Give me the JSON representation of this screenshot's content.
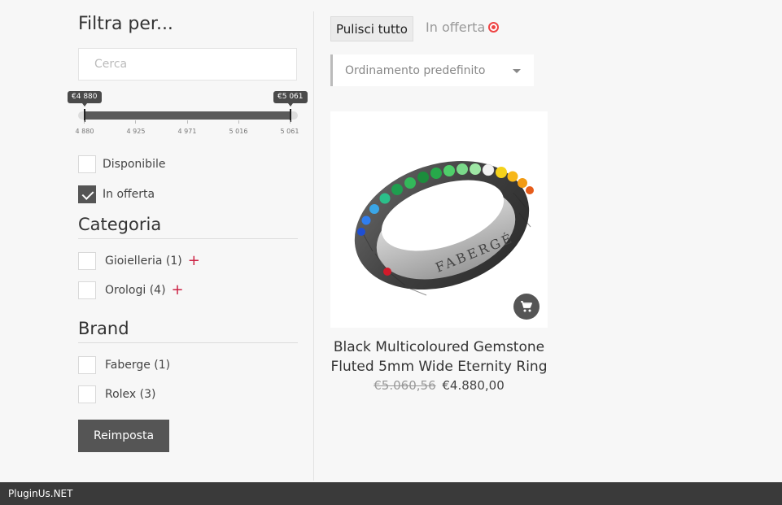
{
  "sidebar": {
    "title": "Filtra per...",
    "search_placeholder": "Cerca",
    "price_slider": {
      "min_label": "€4 880",
      "max_label": "€5 061",
      "ticks": [
        "4 880",
        "4 925",
        "4 971",
        "5 016",
        "5 061"
      ]
    },
    "availability": {
      "label": "Disponibile",
      "checked": false
    },
    "on_sale": {
      "label": "In offerta",
      "checked": true
    },
    "category": {
      "title": "Categoria",
      "items": [
        {
          "label": "Gioielleria (1)"
        },
        {
          "label": "Orologi (4)"
        }
      ]
    },
    "brand": {
      "title": "Brand",
      "items": [
        {
          "label": "Faberge (1)"
        },
        {
          "label": "Rolex (3)"
        }
      ]
    },
    "reset_label": "Reimposta"
  },
  "toolbar": {
    "clear_all_label": "Pulisci tutto",
    "active_filter_label": "In offerta",
    "sort_label": "Ordinamento predefinito"
  },
  "product": {
    "title": "Black Multicoloured Gemstone Fluted 5mm Wide Eternity Ring",
    "old_price": "€5.060,56",
    "new_price": "€4.880,00",
    "engraving": "FABERGÉ"
  },
  "footer": {
    "text": "PluginUs.NET"
  },
  "colors": {
    "background": "#f7f7f7",
    "dark_button": "#555555",
    "accent_red": "#cc2244"
  }
}
